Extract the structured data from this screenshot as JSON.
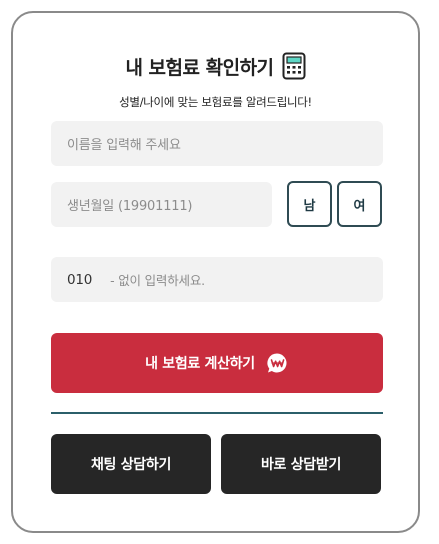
{
  "header": {
    "title": "내 보험료 확인하기",
    "subtitle": "성별/나이에 맞는 보험료를 알려드립니다!",
    "title_icon": "calculator-icon"
  },
  "form": {
    "name_placeholder": "이름을 입력해 주세요",
    "birth_placeholder": "생년월일 (19901111)",
    "gender_male": "남",
    "gender_female": "여",
    "phone_prefix": "010",
    "phone_hint": "- 없이 입력하세요."
  },
  "actions": {
    "calculate_label": "내 보험료 계산하기",
    "calculate_icon": "won-speech-bubble-icon",
    "chat_label": "채팅 상담하기",
    "consult_label": "바로 상담받기"
  },
  "colors": {
    "accent_red": "#c92d3e",
    "dark_button": "#262626",
    "gender_border": "#2f4b53",
    "divider": "#2b5f6a",
    "calculator_screen": "#5ed6c5"
  }
}
